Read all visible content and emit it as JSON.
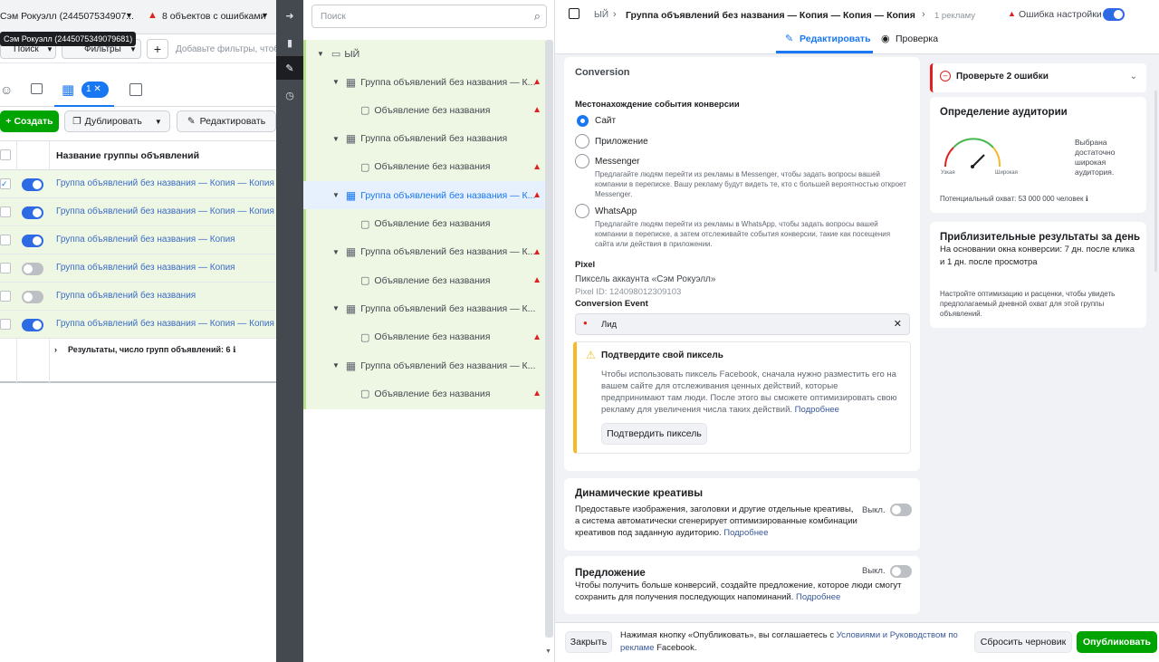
{
  "left": {
    "account": "Сэм Рокуэлл (244507534907...",
    "errors_label": "8 объектов с ошибками",
    "tooltip": "Сэм Рокуэлл (2445075349079681)",
    "search_label": "Поиск",
    "filters_label": "Фильтры",
    "add_filters_placeholder": "Добавьте фильтры, чтобы",
    "selection_count": "1",
    "create_label": "Создать",
    "duplicate_label": "Дублировать",
    "edit_label": "Редактировать",
    "column_header": "Название группы объявлений",
    "rows": [
      {
        "name": "Группа объявлений без названия — Копия — Копия — К",
        "toggle": "on",
        "checked": true
      },
      {
        "name": "Группа объявлений без названия — Копия — Копия",
        "toggle": "on",
        "checked": false
      },
      {
        "name": "Группа объявлений без названия — Копия",
        "toggle": "on",
        "checked": false
      },
      {
        "name": "Группа объявлений без названия — Копия",
        "toggle": "off",
        "checked": false
      },
      {
        "name": "Группа объявлений без названия",
        "toggle": "off",
        "checked": false
      },
      {
        "name": "Группа объявлений без названия — Копия — Копия — К",
        "toggle": "on",
        "checked": false
      }
    ],
    "results_label": "Результаты, число групп объявлений: 6"
  },
  "tree": {
    "search_placeholder": "Поиск",
    "campaign": "ЫЙ",
    "items": [
      {
        "level": 1,
        "label": "Группа объявлений без названия — К...",
        "warn": true,
        "selected": false
      },
      {
        "level": 2,
        "label": "Объявление без названия",
        "warn": true,
        "selected": false
      },
      {
        "level": 1,
        "label": "Группа объявлений без названия",
        "warn": false,
        "selected": false
      },
      {
        "level": 2,
        "label": "Объявление без названия",
        "warn": true,
        "selected": false
      },
      {
        "level": 1,
        "label": "Группа объявлений без названия — К...",
        "warn": true,
        "selected": true
      },
      {
        "level": 2,
        "label": "Объявление без названия",
        "warn": false,
        "selected": false
      },
      {
        "level": 1,
        "label": "Группа объявлений без названия — К...",
        "warn": true,
        "selected": false
      },
      {
        "level": 2,
        "label": "Объявление без названия",
        "warn": true,
        "selected": false
      },
      {
        "level": 1,
        "label": "Группа объявлений без названия — К...",
        "warn": false,
        "selected": false
      },
      {
        "level": 2,
        "label": "Объявление без названия",
        "warn": true,
        "selected": false
      },
      {
        "level": 1,
        "label": "Группа объявлений без названия — К...",
        "warn": false,
        "selected": false
      },
      {
        "level": 2,
        "label": "Объявление без названия",
        "warn": true,
        "selected": false
      }
    ]
  },
  "header": {
    "crumb1": "ЫЙ",
    "crumb2": "Группа объявлений без названия — Копия — Копия — Копия",
    "crumb3": "1 рекламу",
    "error_label": "Ошибка настройки",
    "tab_edit": "Редактировать",
    "tab_review": "Проверка"
  },
  "conversion": {
    "title": "Conversion",
    "location_label": "Местонахождение события конверсии",
    "opt_site": "Сайт",
    "opt_app": "Приложение",
    "opt_messenger": "Messenger",
    "messenger_desc": "Предлагайте людям перейти из рекламы в Messenger, чтобы задать вопросы вашей компании в переписке. Вашу рекламу будут видеть те, кто с большей вероятностью откроет Messenger.",
    "opt_whatsapp": "WhatsApp",
    "whatsapp_desc": "Предлагайте людям перейти из рекламы в WhatsApp, чтобы задать вопросы вашей компании в переписке, а затем отслеживайте события конверсии, такие как посещения сайта или действия в приложении.",
    "pixel_label": "Pixel",
    "pixel_name": "Пиксель аккаунта «Сэм Рокуэлл»",
    "pixel_id": "Pixel ID: 124098012309103",
    "event_label": "Conversion Event",
    "event_value": "Лид",
    "confirm_title": "Подтвердите свой пиксель",
    "confirm_text": "Чтобы использовать пиксель Facebook, сначала нужно разместить его на вашем сайте для отслеживания ценных действий, которые предпринимают там люди. После этого вы сможете оптимизировать свою рекламу для увеличения числа таких действий.",
    "confirm_more": "Подробнее",
    "confirm_button": "Подтвердить пиксель"
  },
  "dynamic": {
    "title": "Динамические креативы",
    "text": "Предоставьте изображения, заголовки и другие отдельные креативы, а система автоматически сгенерирует оптимизированные комбинации креативов под заданную аудиторию.",
    "more": "Подробнее",
    "state": "Выкл."
  },
  "offer": {
    "title": "Предложение",
    "text": "Чтобы получить больше конверсий, создайте предложение, которое люди смогут сохранить для получения последующих напоминаний.",
    "more": "Подробнее",
    "state": "Выкл."
  },
  "side": {
    "errors_banner": "Проверьте 2 ошибки",
    "audience_title": "Определение аудитории",
    "gauge_narrow": "Узкая",
    "gauge_wide": "Широкая",
    "audience_status": "Выбрана достаточно широкая аудитория.",
    "reach": "Потенциальный охват: 53 000 000 человек",
    "results_title": "Приблизительные результаты за день",
    "results_sub": "На основании окна конверсии: 7 дн. после клика и 1 дн. после просмотра",
    "results_note": "Настройте оптимизацию и расценки, чтобы увидеть предполагаемый дневной охват для этой группы объявлений."
  },
  "footer": {
    "close": "Закрыть",
    "notice": "Нажимая кнопку «Опубликовать», вы соглашаетесь с",
    "terms": "Условиями и Руководством по рекламе",
    "notice_end": "Facebook.",
    "reset": "Сбросить черновик",
    "publish": "Опубликовать"
  },
  "colors": {
    "accent": "#1877f2",
    "publish": "#00a400",
    "error": "#e02020",
    "tree_bg": "#eef6e4"
  }
}
